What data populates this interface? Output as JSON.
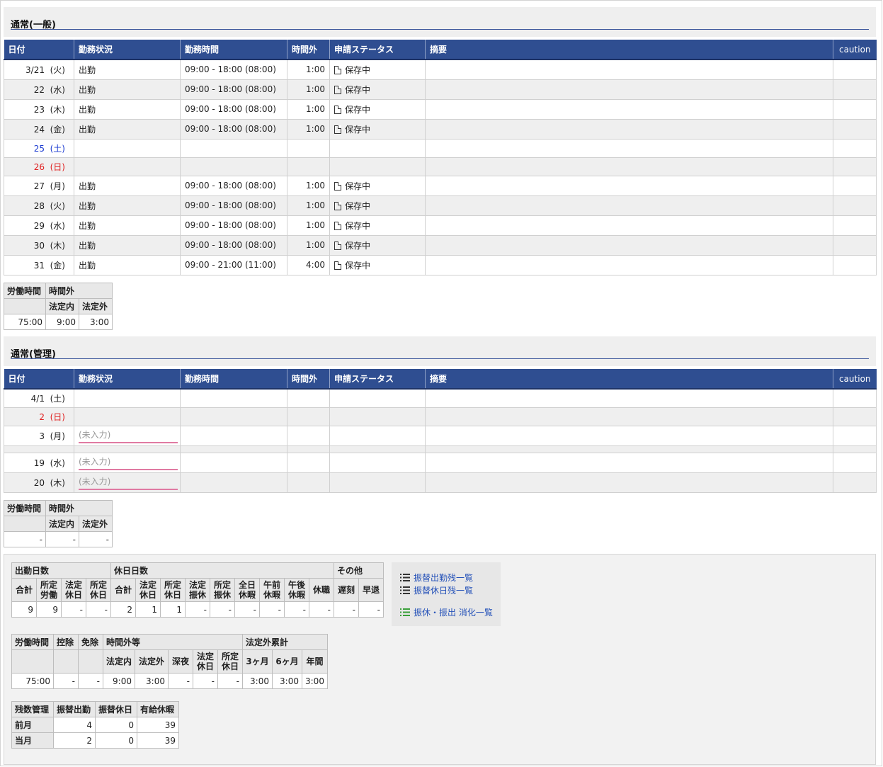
{
  "section1": {
    "title": "通常(一般)",
    "headers": {
      "date": "日付",
      "status": "勤務状況",
      "hours": "勤務時間",
      "ot": "時間外",
      "apply": "申請ステータス",
      "summary": "摘要",
      "caution": "caution"
    },
    "rows": [
      {
        "date": "3/21",
        "wd": "(火)",
        "status": "出勤",
        "hours": "09:00 - 18:00 (08:00)",
        "ot": "1:00",
        "apply": "保存中"
      },
      {
        "date": "22",
        "wd": "(水)",
        "status": "出勤",
        "hours": "09:00 - 18:00 (08:00)",
        "ot": "1:00",
        "apply": "保存中"
      },
      {
        "date": "23",
        "wd": "(木)",
        "status": "出勤",
        "hours": "09:00 - 18:00 (08:00)",
        "ot": "1:00",
        "apply": "保存中"
      },
      {
        "date": "24",
        "wd": "(金)",
        "status": "出勤",
        "hours": "09:00 - 18:00 (08:00)",
        "ot": "1:00",
        "apply": "保存中"
      },
      {
        "date": "25",
        "wd": "(土)",
        "status": "",
        "hours": "",
        "ot": "",
        "apply": ""
      },
      {
        "date": "26",
        "wd": "(日)",
        "status": "",
        "hours": "",
        "ot": "",
        "apply": ""
      },
      {
        "date": "27",
        "wd": "(月)",
        "status": "出勤",
        "hours": "09:00 - 18:00 (08:00)",
        "ot": "1:00",
        "apply": "保存中"
      },
      {
        "date": "28",
        "wd": "(火)",
        "status": "出勤",
        "hours": "09:00 - 18:00 (08:00)",
        "ot": "1:00",
        "apply": "保存中"
      },
      {
        "date": "29",
        "wd": "(水)",
        "status": "出勤",
        "hours": "09:00 - 18:00 (08:00)",
        "ot": "1:00",
        "apply": "保存中"
      },
      {
        "date": "30",
        "wd": "(木)",
        "status": "出勤",
        "hours": "09:00 - 18:00 (08:00)",
        "ot": "1:00",
        "apply": "保存中"
      },
      {
        "date": "31",
        "wd": "(金)",
        "status": "出勤",
        "hours": "09:00 - 21:00 (11:00)",
        "ot": "4:00",
        "apply": "保存中"
      }
    ],
    "summary": {
      "labor": "労働時間",
      "ot": "時間外",
      "legal_in": "法定内",
      "legal_out": "法定外",
      "labor_val": "75:00",
      "legal_in_val": "9:00",
      "legal_out_val": "3:00"
    }
  },
  "section2": {
    "title": "通常(管理)",
    "rows": [
      {
        "date": "4/1",
        "wd": "(土)"
      },
      {
        "date": "2",
        "wd": "(日)"
      },
      {
        "date": "3",
        "wd": "(月)",
        "placeholder": "(未入力)"
      },
      {
        "date": "19",
        "wd": "(水)",
        "placeholder": "(未入力)"
      },
      {
        "date": "20",
        "wd": "(木)",
        "placeholder": "(未入力)"
      }
    ],
    "summary": {
      "labor_val": "-",
      "legal_in_val": "-",
      "legal_out_val": "-"
    }
  },
  "days": {
    "work_days": "出勤日数",
    "holiday_days": "休日日数",
    "other": "その他",
    "cols": [
      "合計",
      "所定\n労働",
      "法定\n休日",
      "所定\n休日",
      "合計",
      "法定\n休日",
      "所定\n休日",
      "法定\n振休",
      "所定\n振休",
      "全日\n休暇",
      "午前\n休暇",
      "午後\n休暇",
      "休職",
      "遅刻",
      "早退"
    ],
    "values": [
      "9",
      "9",
      "-",
      "-",
      "2",
      "1",
      "1",
      "-",
      "-",
      "-",
      "-",
      "-",
      "-",
      "-",
      "-"
    ]
  },
  "hours": {
    "labor": "労働時間",
    "deduct": "控除",
    "exempt": "免除",
    "ot_etc": "時間外等",
    "legal_out_cum": "法定外累計",
    "cols": [
      "法定内",
      "法定外",
      "深夜",
      "法定\n休日",
      "所定\n休日",
      "3ヶ月",
      "6ヶ月",
      "年間"
    ],
    "values": [
      "75:00",
      "-",
      "-",
      "9:00",
      "3:00",
      "-",
      "-",
      "-",
      "3:00",
      "3:00",
      "3:00"
    ]
  },
  "balance": {
    "headers": [
      "残数管理",
      "振替出勤",
      "振替休日",
      "有給休暇"
    ],
    "rows": [
      {
        "label": "前月",
        "v": [
          "4",
          "0",
          "39"
        ]
      },
      {
        "label": "当月",
        "v": [
          "2",
          "0",
          "39"
        ]
      }
    ]
  },
  "links": {
    "transfer_work": "振替出勤残一覧",
    "transfer_holiday": "振替休日残一覧",
    "consumption": "振休・振出 消化一覧"
  },
  "colors": {
    "header_blue": "#2f4e91",
    "saturday": "#1a3ad1",
    "sunday": "#e02020",
    "link": "#2350b8"
  }
}
